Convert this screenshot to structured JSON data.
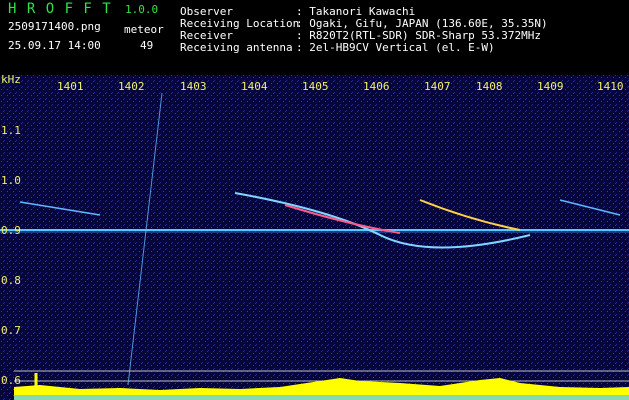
{
  "app": {
    "name": "H R O F F T",
    "version": "1.0.0"
  },
  "file": {
    "name": "2509171400.png",
    "datetime": "25.09.17 14:00"
  },
  "counter": {
    "label": "meteor",
    "value": "49"
  },
  "info": {
    "observer_label": "Observer",
    "observer_value": ": Takanori Kawachi",
    "location_label": "Receiving Location",
    "location_value": ": Ogaki, Gifu, JAPAN (136.60E, 35.35N)",
    "receiver_label": "Receiver",
    "receiver_value": ": R820T2(RTL-SDR) SDR-Sharp 53.372MHz",
    "antenna_label": "Receiving antenna",
    "antenna_value": ": 2el-HB9CV Vertical (el. E-W)"
  },
  "axis": {
    "unit": "kHz",
    "x_ticks": [
      "1401",
      "1402",
      "1403",
      "1404",
      "1405",
      "1406",
      "1407",
      "1408",
      "1409",
      "1410"
    ],
    "y_ticks": [
      "1.1",
      "1.0",
      "0.9",
      "0.8",
      "0.7",
      "0.6"
    ]
  },
  "colors": {
    "background": "#06063a",
    "text_green": "#2ee24a",
    "text_yellow": "#f2f06a",
    "carrier": "#55c8ff",
    "signal_bar": "#ffff00"
  }
}
